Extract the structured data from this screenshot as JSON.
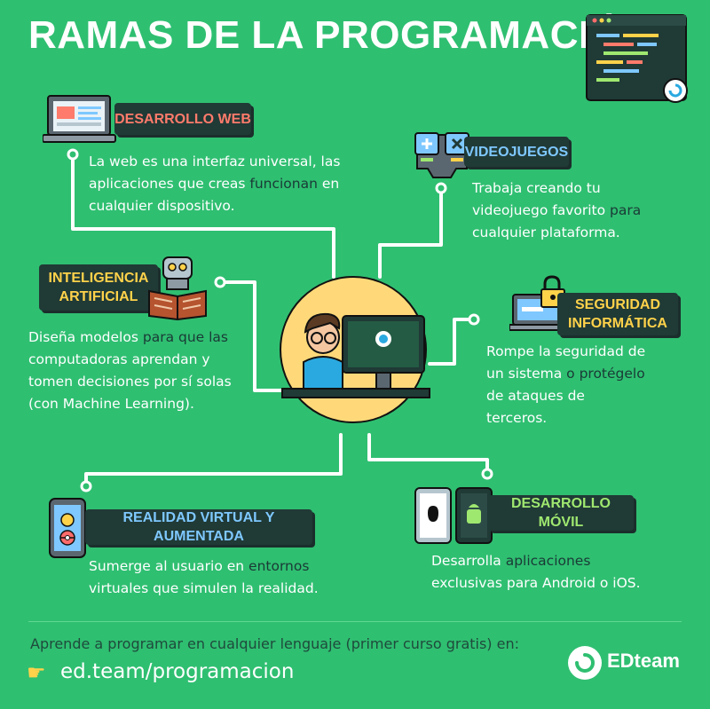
{
  "title": "RAMAS DE LA PROGRAMACIÓN",
  "branches": {
    "web": {
      "label": "DESARROLLO WEB",
      "desc": [
        "La web es una interfaz universal, las",
        "aplicaciones que creas ",
        "funcionan",
        " en",
        "cualquier dispositivo."
      ]
    },
    "games": {
      "label": "VIDEOJUEGOS",
      "desc": [
        "Trabaja creando tu",
        "videojuego favorito ",
        "para",
        "cualquier plataforma."
      ]
    },
    "ai": {
      "label": "INTELIGENCIA\nARTIFICIAL",
      "desc": [
        "Diseña modelos ",
        "para que las",
        "computadoras aprendan y",
        "tomen decisiones por sí solas",
        "(con Machine Learning)."
      ]
    },
    "security": {
      "label": "SEGURIDAD\nINFORMÁTICA",
      "desc": [
        "Rompe la seguridad de",
        "un sistema ",
        "o protégelo",
        "de ataques de",
        "terceros."
      ]
    },
    "vr": {
      "label": "REALIDAD VIRTUAL Y AUMENTADA",
      "desc": [
        "Sumerge al usuario en ",
        "entornos",
        "virtuales que simulen la realidad."
      ]
    },
    "mobile": {
      "label": "DESARROLLO MÓVIL",
      "desc": [
        "Desarrolla ",
        "aplicaciones",
        "exclusivas ",
        "para Android o iOS."
      ]
    }
  },
  "footer": {
    "text": "Aprende a programar en cualquier lenguaje (primer curso gratis) en:",
    "link": "ed.team/programacion",
    "brand": "EDteam"
  },
  "colors": {
    "background": "#2fbf71",
    "label_bg": "#203a36",
    "highlight": "#1a3a36",
    "accent_yellow": "#ffd24a"
  }
}
